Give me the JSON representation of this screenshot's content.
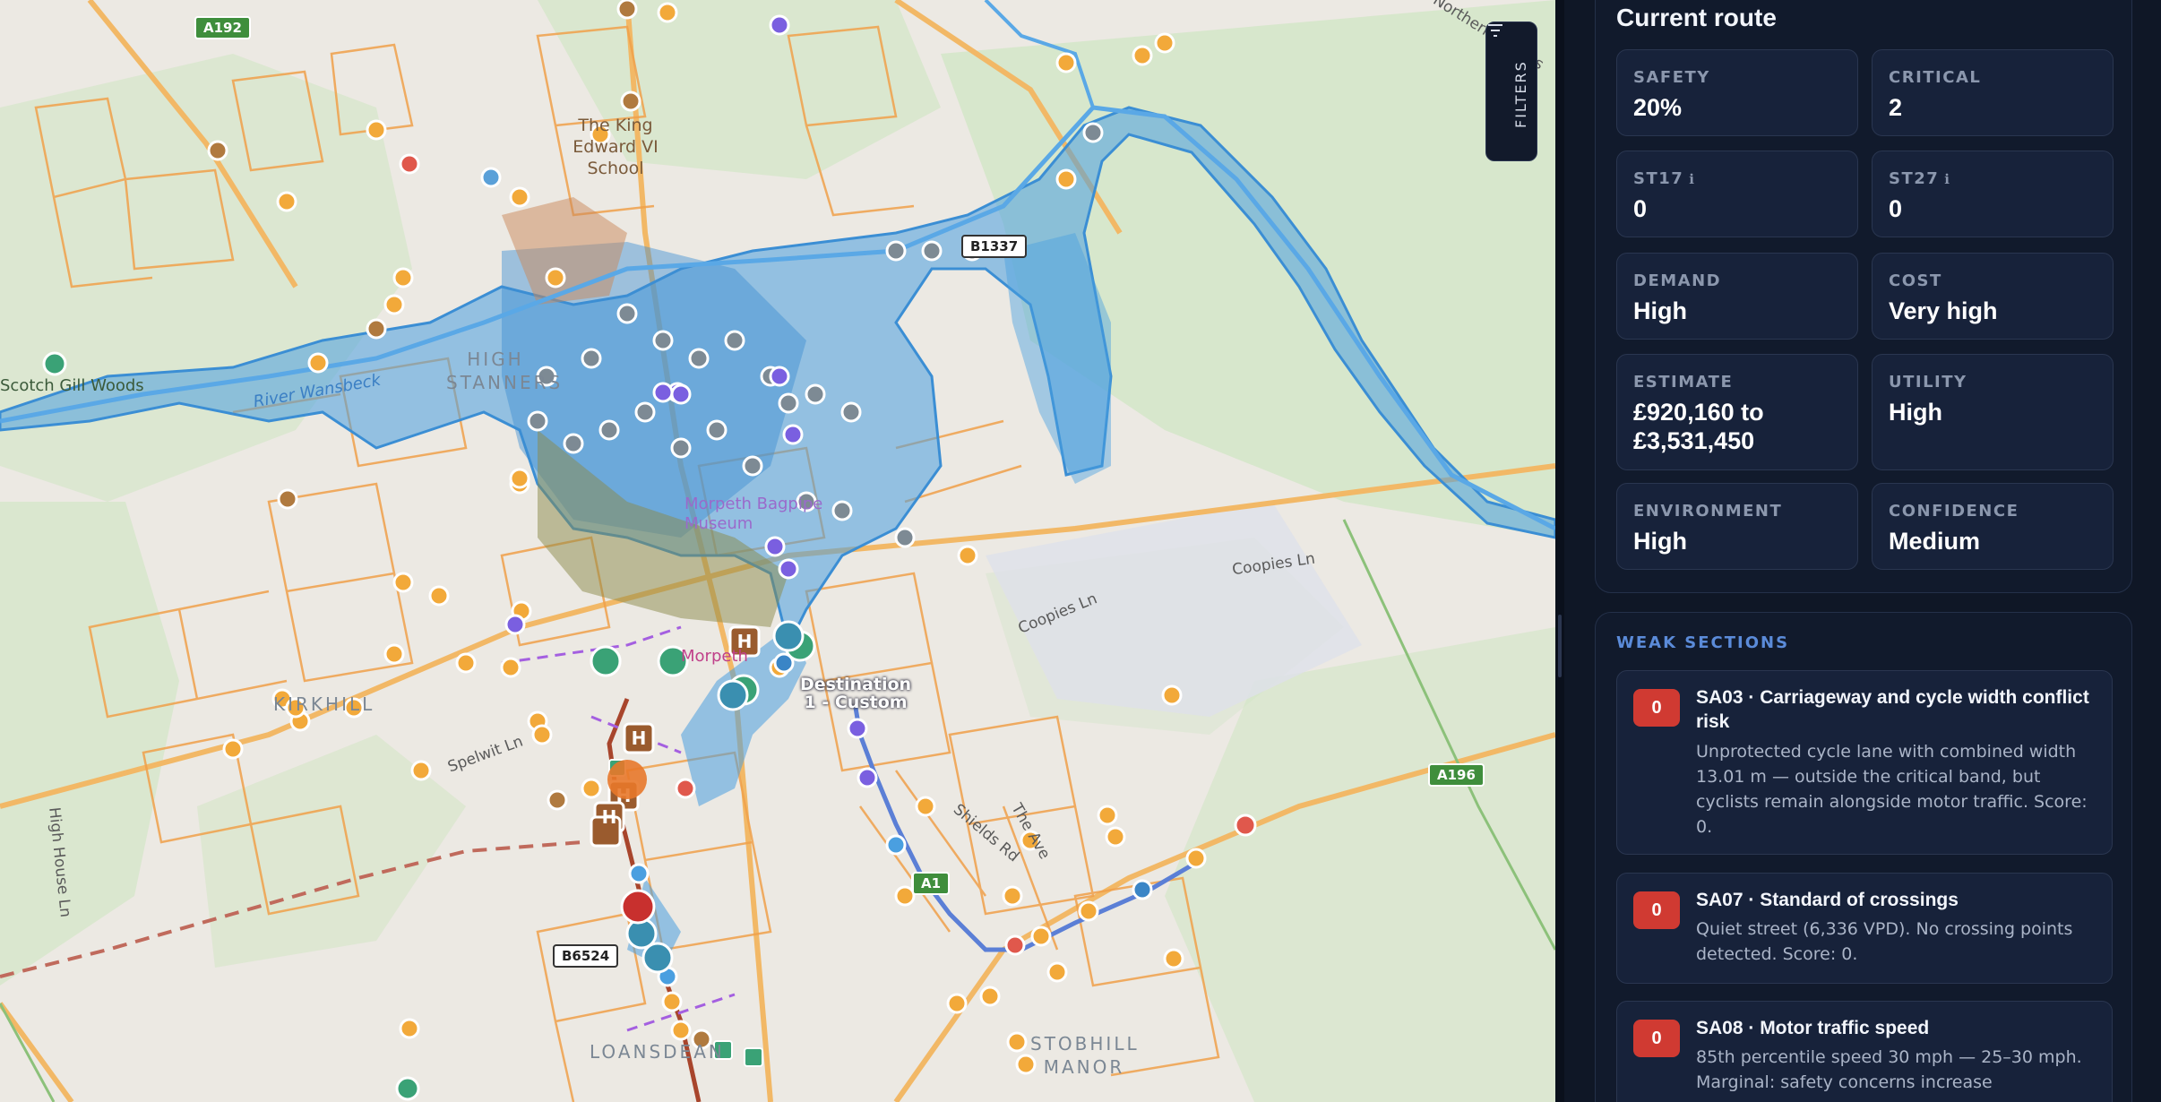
{
  "map": {
    "place_labels": {
      "school": "The King Edward VI School",
      "high_stanners": "HIGH STANNERS",
      "kirkhill": "KIRKHILL",
      "loansdean": "LOANSDEAN",
      "stobhill_manor": "STOBHILL MANOR",
      "scotch_gill_woods": "Scotch Gill Woods",
      "river_wansbeck": "River Wansbeck",
      "morpeth": "Morpeth",
      "museum": "Morpeth Bagpipe Museum"
    },
    "street_labels": {
      "coopies_ln_1": "Coopies Ln",
      "coopies_ln_2": "Coopies Ln",
      "spelwit_ln": "Spelwit Ln",
      "high_house_ln": "High House Ln",
      "shields_rd": "Shields Rd",
      "the_avenue": "The Ave",
      "bypass": "Morpeth Northern Bypass"
    },
    "road_shields": {
      "a192": "A192",
      "b1337": "B1337",
      "a196": "A196",
      "a1": "A1",
      "b6524": "B6524"
    },
    "destination": {
      "line1": "Destination",
      "line2": "1 - Custom"
    },
    "filters_label": "FILTERS",
    "filters_icon": "filter-icon",
    "colors": {
      "flood_zone": "#4a9fe0",
      "park": "#cfe6c2",
      "road_minor": "#f0a04a",
      "route": "#5b7fd6"
    }
  },
  "panel": {
    "current_route": {
      "title": "Current route",
      "metrics": [
        {
          "label": "SAFETY",
          "value": "20%",
          "info": ""
        },
        {
          "label": "CRITICAL",
          "value": "2",
          "info": ""
        },
        {
          "label": "ST17",
          "value": "0",
          "info": "ℹ"
        },
        {
          "label": "ST27",
          "value": "0",
          "info": "ℹ"
        },
        {
          "label": "DEMAND",
          "value": "High",
          "info": ""
        },
        {
          "label": "COST",
          "value": "Very high",
          "info": ""
        },
        {
          "label": "ESTIMATE",
          "value": "£920,160 to £3,531,450",
          "info": ""
        },
        {
          "label": "UTILITY",
          "value": "High",
          "info": ""
        },
        {
          "label": "ENVIRONMENT",
          "value": "High",
          "info": ""
        },
        {
          "label": "CONFIDENCE",
          "value": "Medium",
          "info": ""
        }
      ]
    },
    "weak_sections": {
      "title": "WEAK SECTIONS",
      "items": [
        {
          "score": "0",
          "title": "SA03 · Carriageway and cycle width conflict risk",
          "description": "Unprotected cycle lane with combined width 13.01 m — outside the critical band, but cyclists remain alongside motor traffic. Score: 0."
        },
        {
          "score": "0",
          "title": "SA07 · Standard of crossings",
          "description": "Quiet street (6,336 VPD). No crossing points detected. Score: 0."
        },
        {
          "score": "0",
          "title": "SA08 · Motor traffic speed",
          "description": "85th percentile speed 30 mph — 25–30 mph. Marginal: safety concerns increase"
        }
      ]
    }
  }
}
